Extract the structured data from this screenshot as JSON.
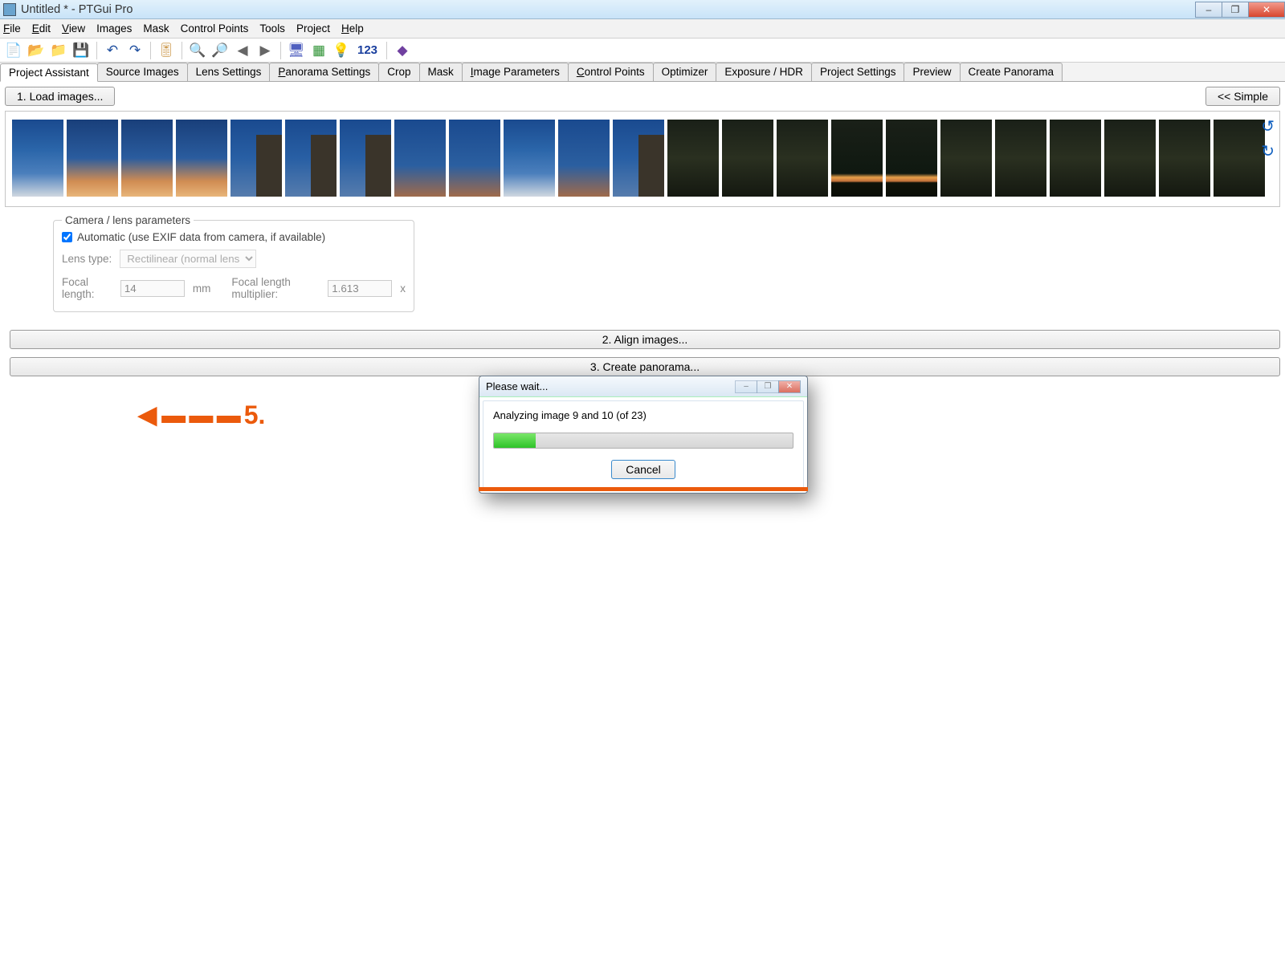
{
  "window": {
    "title": "Untitled * - PTGui Pro",
    "minimize": "–",
    "maximize": "❐",
    "close": "✕"
  },
  "menu": {
    "file": "File",
    "edit": "Edit",
    "view": "View",
    "images": "Images",
    "mask": "Mask",
    "controlpoints": "Control Points",
    "tools": "Tools",
    "project": "Project",
    "help": "Help"
  },
  "toolbar": {
    "t123": "123"
  },
  "tabs": {
    "assistant": "Project Assistant",
    "source": "Source Images",
    "lens": "Lens Settings",
    "pano": "Panorama Settings",
    "crop": "Crop",
    "mask": "Mask",
    "imgparams": "Image Parameters",
    "ctrl": "Control Points",
    "opt": "Optimizer",
    "exp": "Exposure / HDR",
    "proj": "Project Settings",
    "preview": "Preview",
    "create": "Create Panorama"
  },
  "buttons": {
    "load": "1. Load images...",
    "simple": "<< Simple",
    "align": "2. Align images...",
    "createp": "3. Create panorama..."
  },
  "params": {
    "legend": "Camera / lens parameters",
    "auto": "Automatic (use EXIF data from camera, if available)",
    "lenstype_label": "Lens type:",
    "lenstype_value": "Rectilinear (normal lens)",
    "focal_label": "Focal length:",
    "focal_value": "14",
    "focal_unit": "mm",
    "mult_label": "Focal length multiplier:",
    "mult_value": "1.613",
    "mult_unit": "x"
  },
  "dialog": {
    "title": "Please wait...",
    "status": "Analyzing image 9 and 10 (of 23)",
    "cancel": "Cancel"
  },
  "annot": {
    "num": "5."
  },
  "thumbs": [
    "sky1",
    "sky2",
    "sky2",
    "sky2",
    "sky3",
    "sky3",
    "sky3",
    "sky4",
    "sky4",
    "sky1",
    "sky4",
    "sky3",
    "dark1",
    "dark1",
    "dark1",
    "dark2",
    "dark2",
    "dark1",
    "dark1",
    "dark1",
    "dark1",
    "dark1",
    "dark1"
  ]
}
